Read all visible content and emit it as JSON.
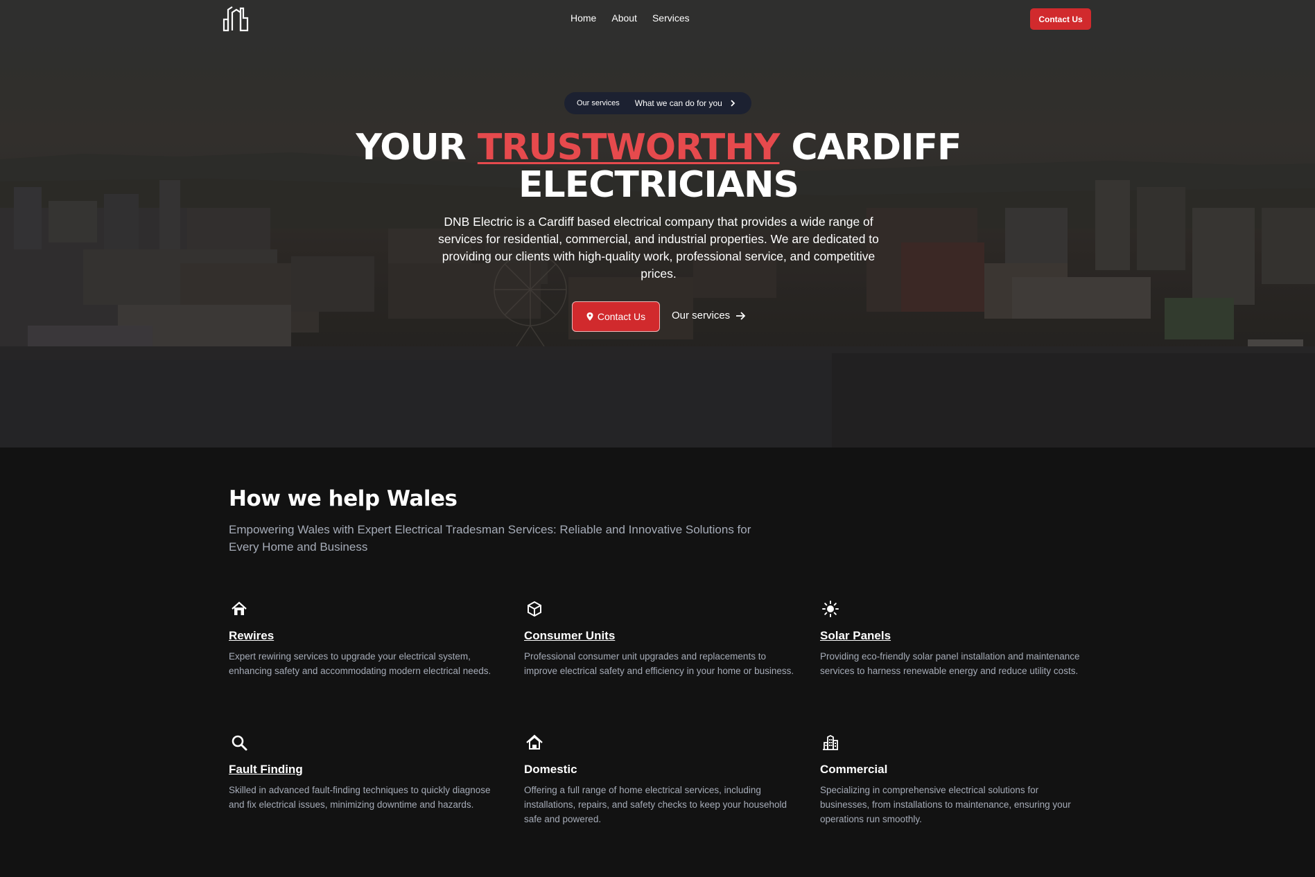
{
  "nav": {
    "logo_text": "dnb",
    "links": [
      "Home",
      "About",
      "Services"
    ],
    "cta_label": "Contact Us"
  },
  "hero": {
    "pill_label": "Our services",
    "pill_text": "What we can do for you",
    "title_before": "YOUR ",
    "title_accent": "TRUSTWORTHY",
    "title_after": " CARDIFF ELECTRICIANS",
    "description": "DNB Electric is a Cardiff based electrical company that provides a wide range of services for residential, commercial, and industrial properties. We are dedicated to providing our clients with high-quality work, professional service, and competitive prices.",
    "contact_button": "Contact Us",
    "services_link": "Our services"
  },
  "services": {
    "title": "How we help Wales",
    "subtitle": "Empowering Wales with Expert Electrical Tradesman Services: Reliable and Innovative Solutions for Every Home and Business",
    "items": [
      {
        "title": "Rewires",
        "icon": "house-icon",
        "description": "Expert rewiring services to upgrade your electrical system, enhancing safety and accommodating modern electrical needs."
      },
      {
        "title": "Consumer Units",
        "icon": "cube-icon",
        "description": "Professional consumer unit upgrades and replacements to improve electrical safety and efficiency in your home or business."
      },
      {
        "title": "Solar Panels",
        "icon": "sun-icon",
        "description": "Providing eco-friendly solar panel installation and maintenance services to harness renewable energy and reduce utility costs."
      },
      {
        "title": "Fault Finding",
        "icon": "search-icon",
        "description": "Skilled in advanced fault-finding techniques to quickly diagnose and fix electrical issues, minimizing downtime and hazards."
      },
      {
        "title": "Domestic",
        "icon": "home-icon",
        "description": "Offering a full range of home electrical services, including installations, repairs, and safety checks to keep your household safe and powered."
      },
      {
        "title": "Commercial",
        "icon": "building-icon",
        "description": "Specializing in comprehensive electrical solutions for businesses, from installations to maintenance, ensuring your operations run smoothly."
      }
    ]
  },
  "colors": {
    "accent": "#d12a2d",
    "accent_text": "#e64a4d",
    "background": "#121212",
    "muted": "#a6acb8",
    "pill": "#1c2131"
  }
}
